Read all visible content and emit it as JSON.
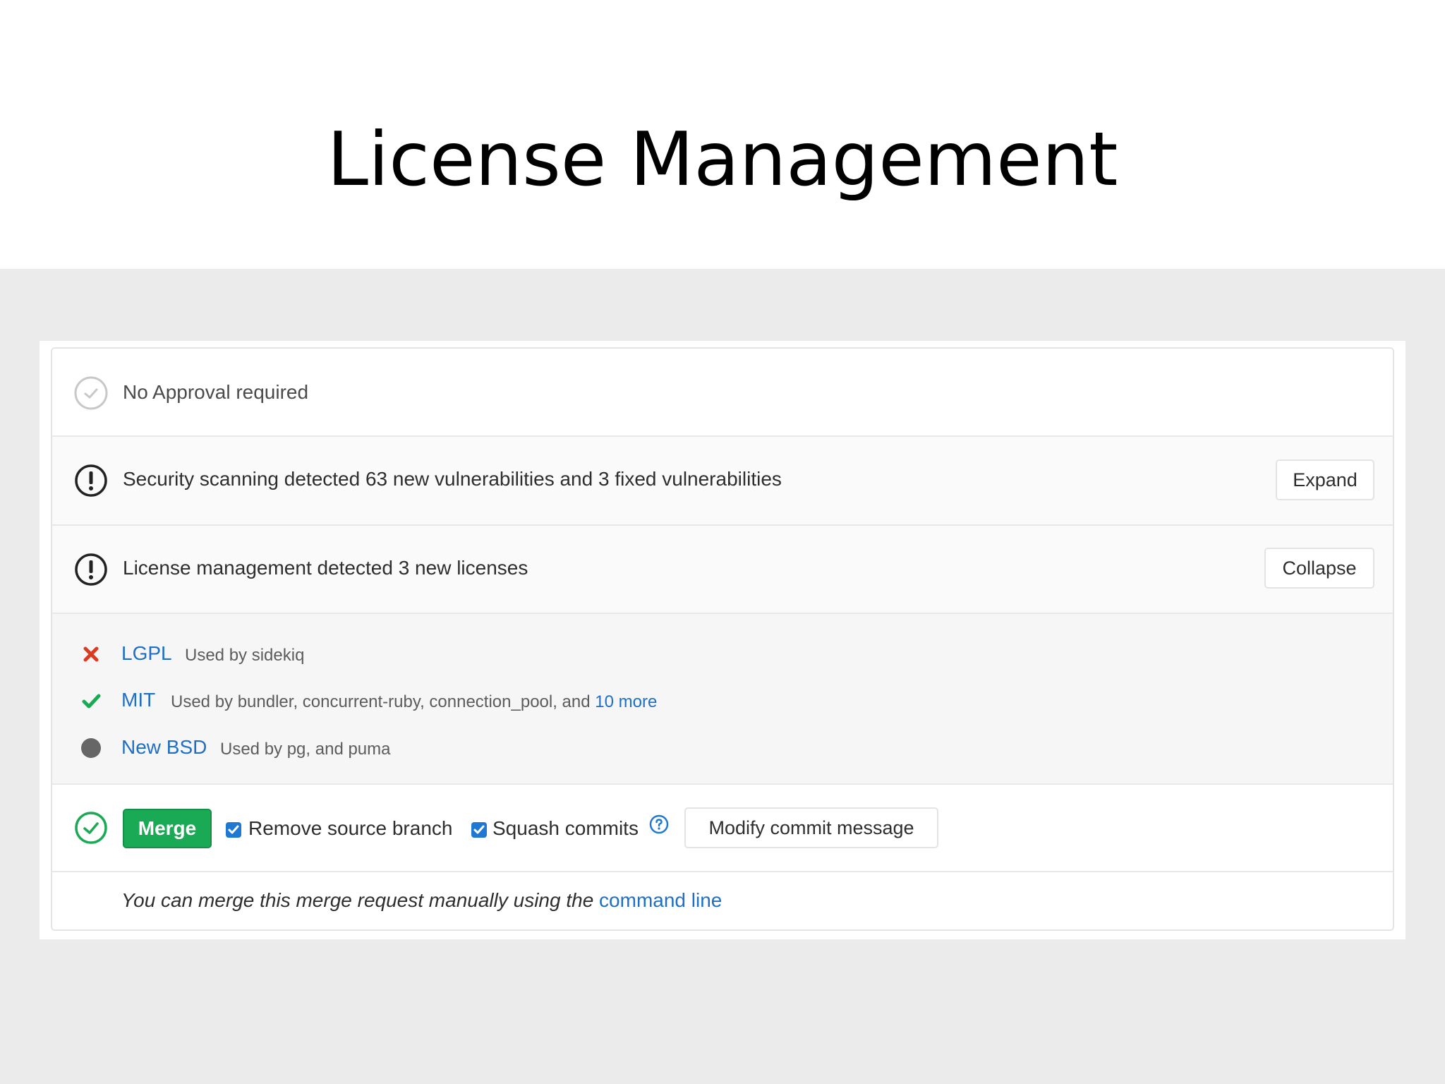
{
  "slide": {
    "title": "License Management"
  },
  "approval": {
    "text": "No Approval required"
  },
  "security": {
    "text": "Security scanning detected 63 new vulnerabilities and 3 fixed vulnerabilities",
    "button": "Expand"
  },
  "license_summary": {
    "text": "License management detected 3 new licenses",
    "button": "Collapse"
  },
  "licenses": [
    {
      "name": "LGPL",
      "status": "denied",
      "icon": "x-icon",
      "used_by": "Used by sidekiq"
    },
    {
      "name": "MIT",
      "status": "approved",
      "icon": "check-icon",
      "used_by": "Used by bundler, concurrent-ruby, connection_pool, and ",
      "more_link": "10 more"
    },
    {
      "name": "New BSD",
      "status": "unknown",
      "icon": "dot-icon",
      "used_by": "Used by pg, and puma"
    }
  ],
  "merge": {
    "button": "Merge",
    "remove_source_branch": "Remove source branch",
    "remove_source_branch_checked": true,
    "squash_commits": "Squash commits",
    "squash_commits_checked": true,
    "modify_commit_message": "Modify commit message"
  },
  "footer": {
    "text": "You can merge this merge request manually using the ",
    "link": "command line"
  },
  "colors": {
    "merge_green": "#1aaa55",
    "link_blue": "#1f6fc5",
    "deny_red": "#db3b21",
    "approve_green": "#1aaa55",
    "neutral_gray": "#666666"
  }
}
